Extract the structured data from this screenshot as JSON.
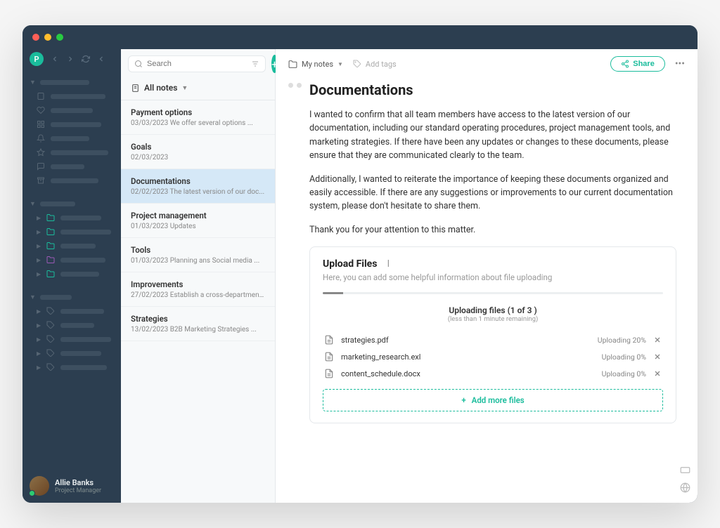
{
  "sidebar": {
    "user_initial": "P",
    "user_name": "Allie Banks",
    "user_role": "Project Manager"
  },
  "search": {
    "placeholder": "Search"
  },
  "notes_header": "All notes",
  "notes": [
    {
      "title": "Payment options",
      "date": "03/03/2023",
      "snippet": "We offer several options ..."
    },
    {
      "title": "Goals",
      "date": "02/03/2023",
      "snippet": ""
    },
    {
      "title": "Documentations",
      "date": "02/02/2023",
      "snippet": "The latest version of our doc..."
    },
    {
      "title": "Project management",
      "date": "01/03/2023",
      "snippet": "Updates"
    },
    {
      "title": "Tools",
      "date": "01/03/2023",
      "snippet": "Planning ans Social media ..."
    },
    {
      "title": "Improvements",
      "date": "27/02/2023",
      "snippet": "Establish a cross-department ..."
    },
    {
      "title": "Strategies",
      "date": "13/02/2023",
      "snippet": "B2B Marketing Strategies ..."
    }
  ],
  "breadcrumb": "My notes",
  "add_tags": "Add tags",
  "share": "Share",
  "doc": {
    "title": "Documentations",
    "p1": "I wanted to confirm that all team members have access to the latest version of our documentation, including our standard operating procedures, project management tools, and marketing strategies. If there have been any updates or changes to these documents, please ensure that they are communicated clearly to the team.",
    "p2": "Additionally, I wanted to reiterate the importance of keeping these documents organized and easily accessible. If there are any suggestions or improvements to our current documentation system, please don't hesitate to share them.",
    "p3": "Thank you for your attention to this matter."
  },
  "upload": {
    "title": "Upload Files",
    "subtitle": "Here, you can add some helpful information about file uploading",
    "header": "Uploading files (1 of 3 )",
    "remaining": "(less than 1 minute remaining)",
    "files": [
      {
        "name": "strategies.pdf",
        "status": "Uploading 20%"
      },
      {
        "name": "marketing_research.exl",
        "status": "Uploading 0%"
      },
      {
        "name": "content_schedule.docx",
        "status": "Uploading 0%"
      }
    ],
    "add_more": "Add more files"
  }
}
